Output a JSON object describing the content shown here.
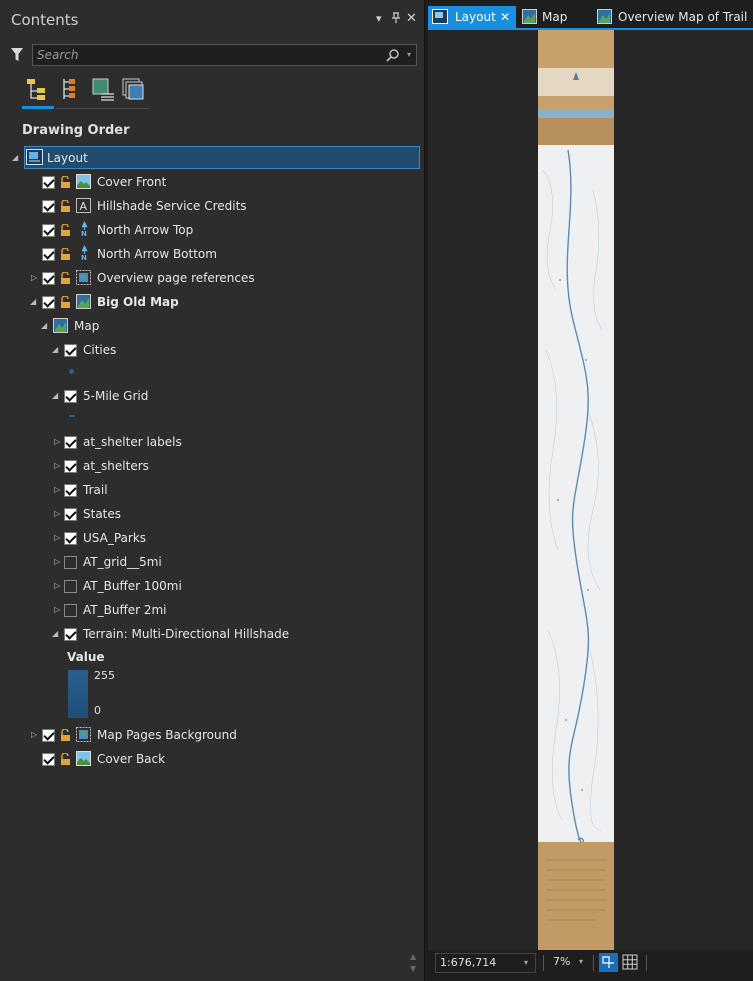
{
  "pane": {
    "title": "Contents",
    "search_placeholder": "Search",
    "drawing_order_heading": "Drawing Order",
    "header_buttons": [
      "▾",
      "⊓",
      "✕"
    ]
  },
  "tree": {
    "layout_root": "Layout",
    "items": [
      {
        "label": "Cover Front"
      },
      {
        "label": "Hillshade Service Credits"
      },
      {
        "label": "North Arrow Top"
      },
      {
        "label": "North Arrow Bottom"
      },
      {
        "label": "Overview page references"
      },
      {
        "label": "Big Old Map"
      },
      {
        "label": "Map"
      },
      {
        "label": "Cities"
      },
      {
        "label": "5-Mile Grid"
      },
      {
        "label": "at_shelter labels"
      },
      {
        "label": "at_shelters"
      },
      {
        "label": "Trail"
      },
      {
        "label": "States"
      },
      {
        "label": "USA_Parks"
      },
      {
        "label": "AT_grid__5mi"
      },
      {
        "label": "AT_Buffer 100mi"
      },
      {
        "label": "AT_Buffer 2mi"
      },
      {
        "label": "Terrain: Multi-Directional Hillshade"
      },
      {
        "label": "Map Pages Background"
      },
      {
        "label": "Cover Back"
      }
    ],
    "legend": {
      "title": "Value",
      "max": "255",
      "min": "0"
    }
  },
  "tabs": [
    {
      "label": "Layout"
    },
    {
      "label": "Map"
    },
    {
      "label": "Overview Map of Trail"
    }
  ],
  "status": {
    "scale": "1:676,714",
    "zoom": "7%"
  },
  "colors": {
    "accent": "#1a8fe0",
    "selection": "#214c6e",
    "lock": "#e3a33a"
  }
}
